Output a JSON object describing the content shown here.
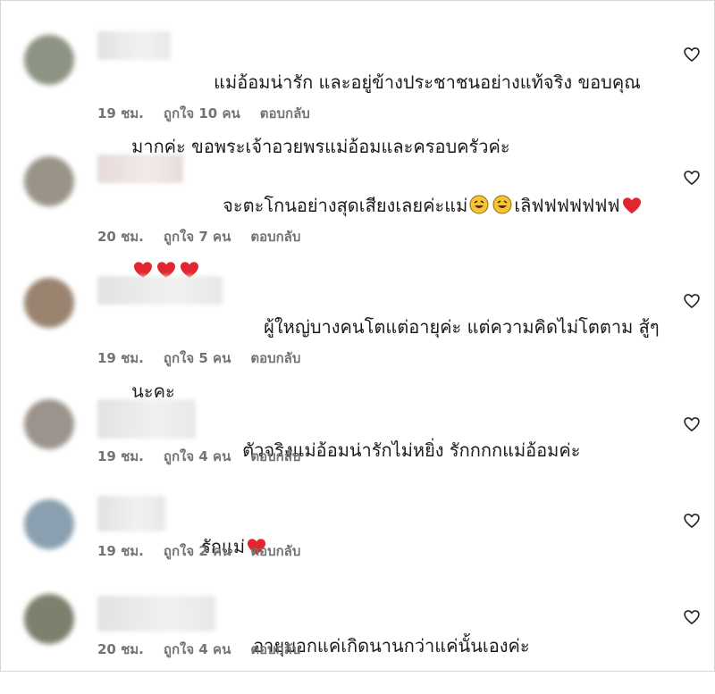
{
  "comments": [
    {
      "text_line1": "แม่อ้อมน่ารัก และอยู่ข้างประชาชนอย่างแท้จริง ขอบคุณ",
      "text_line2": "มากค่ะ ขอพระเจ้าอวยพรแม่อ้อมและครอบครัวค่ะ",
      "time": "19 ชม.",
      "likes": "ถูกใจ 10 คน",
      "reply": "ตอบกลับ",
      "avatar_color": "#8e9484"
    },
    {
      "text_line1": "จะตะโกนอย่างสุดเสียงเลยค่ะแม่",
      "text_mid": "เลิฟฟฟฟฟฟฟ",
      "time": "20 ชม.",
      "likes": "ถูกใจ 7 คน",
      "reply": "ตอบกลับ",
      "avatar_color": "#9a9488"
    },
    {
      "text_line1": "ผู้ใหญ่บางคนโตแต่อายุค่ะ แต่ความคิดไม่โตตาม สู้ๆ",
      "text_line2": "นะคะ",
      "time": "19 ชม.",
      "likes": "ถูกใจ 5 คน",
      "reply": "ตอบกลับ",
      "avatar_color": "#9a8470"
    },
    {
      "text_line1": "ตัวจริงแม่อ้อมน่ารักไม่หยิ่ง รักกกกแม่อ้อมค่ะ",
      "time": "19 ชม.",
      "likes": "ถูกใจ 4 คน",
      "reply": "ตอบกลับ",
      "avatar_color": "#9c948c"
    },
    {
      "text_line1": "รักแม่",
      "time": "19 ชม.",
      "likes": "ถูกใจ 2 คน",
      "reply": "ตอบกลับ",
      "avatar_color": "#8aa0b0"
    },
    {
      "text_line1": "อายุบอกแค่เกิดนานกว่าแค่นั้นเองค่ะ",
      "time": "20 ชม.",
      "likes": "ถูกใจ 4 คน",
      "reply": "ตอบกลับ",
      "avatar_color": "#7e806e"
    }
  ],
  "colors": {
    "heart_red": "#e0262e",
    "meta_gray": "#737373",
    "emoji_yellow": "#f6c433"
  },
  "icons": {
    "like": "heart-outline-icon",
    "emoji": "rolling-laughing-emoji",
    "heart": "red-heart-emoji"
  }
}
